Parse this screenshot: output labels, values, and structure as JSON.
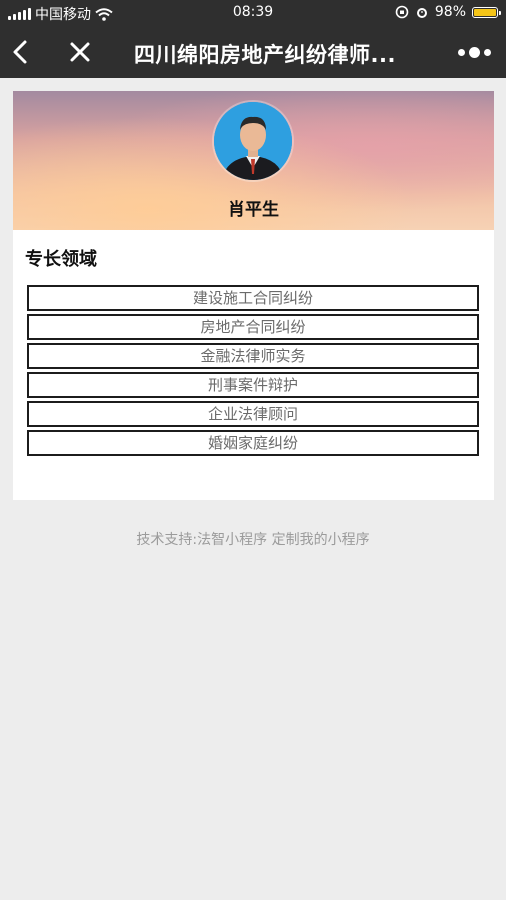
{
  "status_bar": {
    "carrier": "中国移动",
    "time": "08:39",
    "battery_percent": "98%",
    "battery_level": 0.98,
    "battery_color": "#f5c518"
  },
  "nav": {
    "title": "四川绵阳房地产纠纷律师...",
    "back_icon": "chevron-left-icon",
    "close_icon": "close-icon",
    "more_icon": "more-dots-icon"
  },
  "profile": {
    "name": "肖平生",
    "avatar_bg": "#2e9fe0"
  },
  "specialty": {
    "title": "专长领域",
    "items": [
      "建设施工合同纠纷",
      "房地产合同纠纷",
      "金融法律师实务",
      "刑事案件辩护",
      "企业法律顾问",
      "婚姻家庭纠纷"
    ]
  },
  "footer": {
    "support_text": "技术支持:法智小程序",
    "customize_link": "定制我的小程序"
  }
}
